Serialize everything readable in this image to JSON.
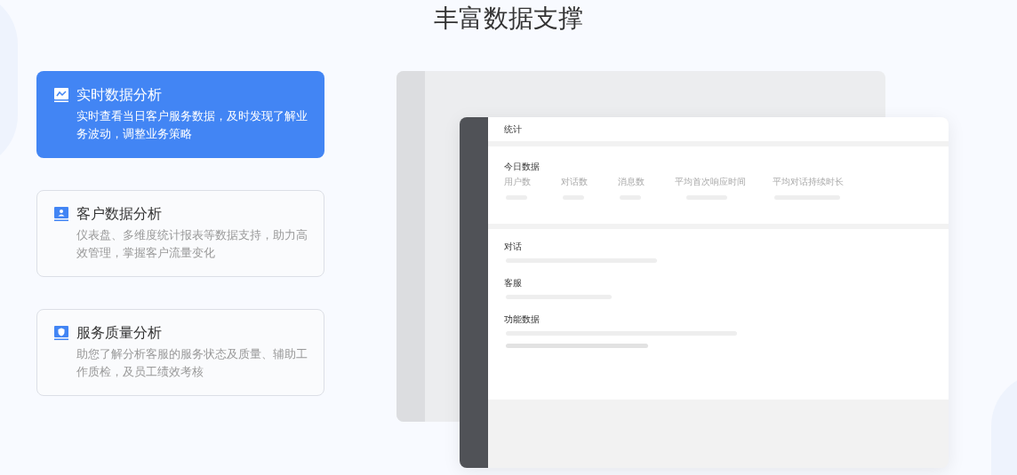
{
  "heading": "丰富数据支撑",
  "features": [
    {
      "title": "实时数据分析",
      "description": "实时查看当日客户服务数据，及时发现了解业务波动，调整业务策略",
      "selected": true
    },
    {
      "title": "客户数据分析",
      "description": "仪表盘、多维度统计报表等数据支持，助力高效管理，掌握客户流量变化",
      "selected": false
    },
    {
      "title": "服务质量分析",
      "description": "助您了解分析客服的服务状态及质量、辅助工作质检，及员工绩效考核",
      "selected": false
    }
  ],
  "preview": {
    "title": "统计",
    "today_label": "今日数据",
    "stats": [
      "用户数",
      "对话数",
      "消息数",
      "平均首次响应时间",
      "平均对话持续时长"
    ],
    "sections": [
      "对话",
      "客服",
      "功能数据"
    ]
  }
}
